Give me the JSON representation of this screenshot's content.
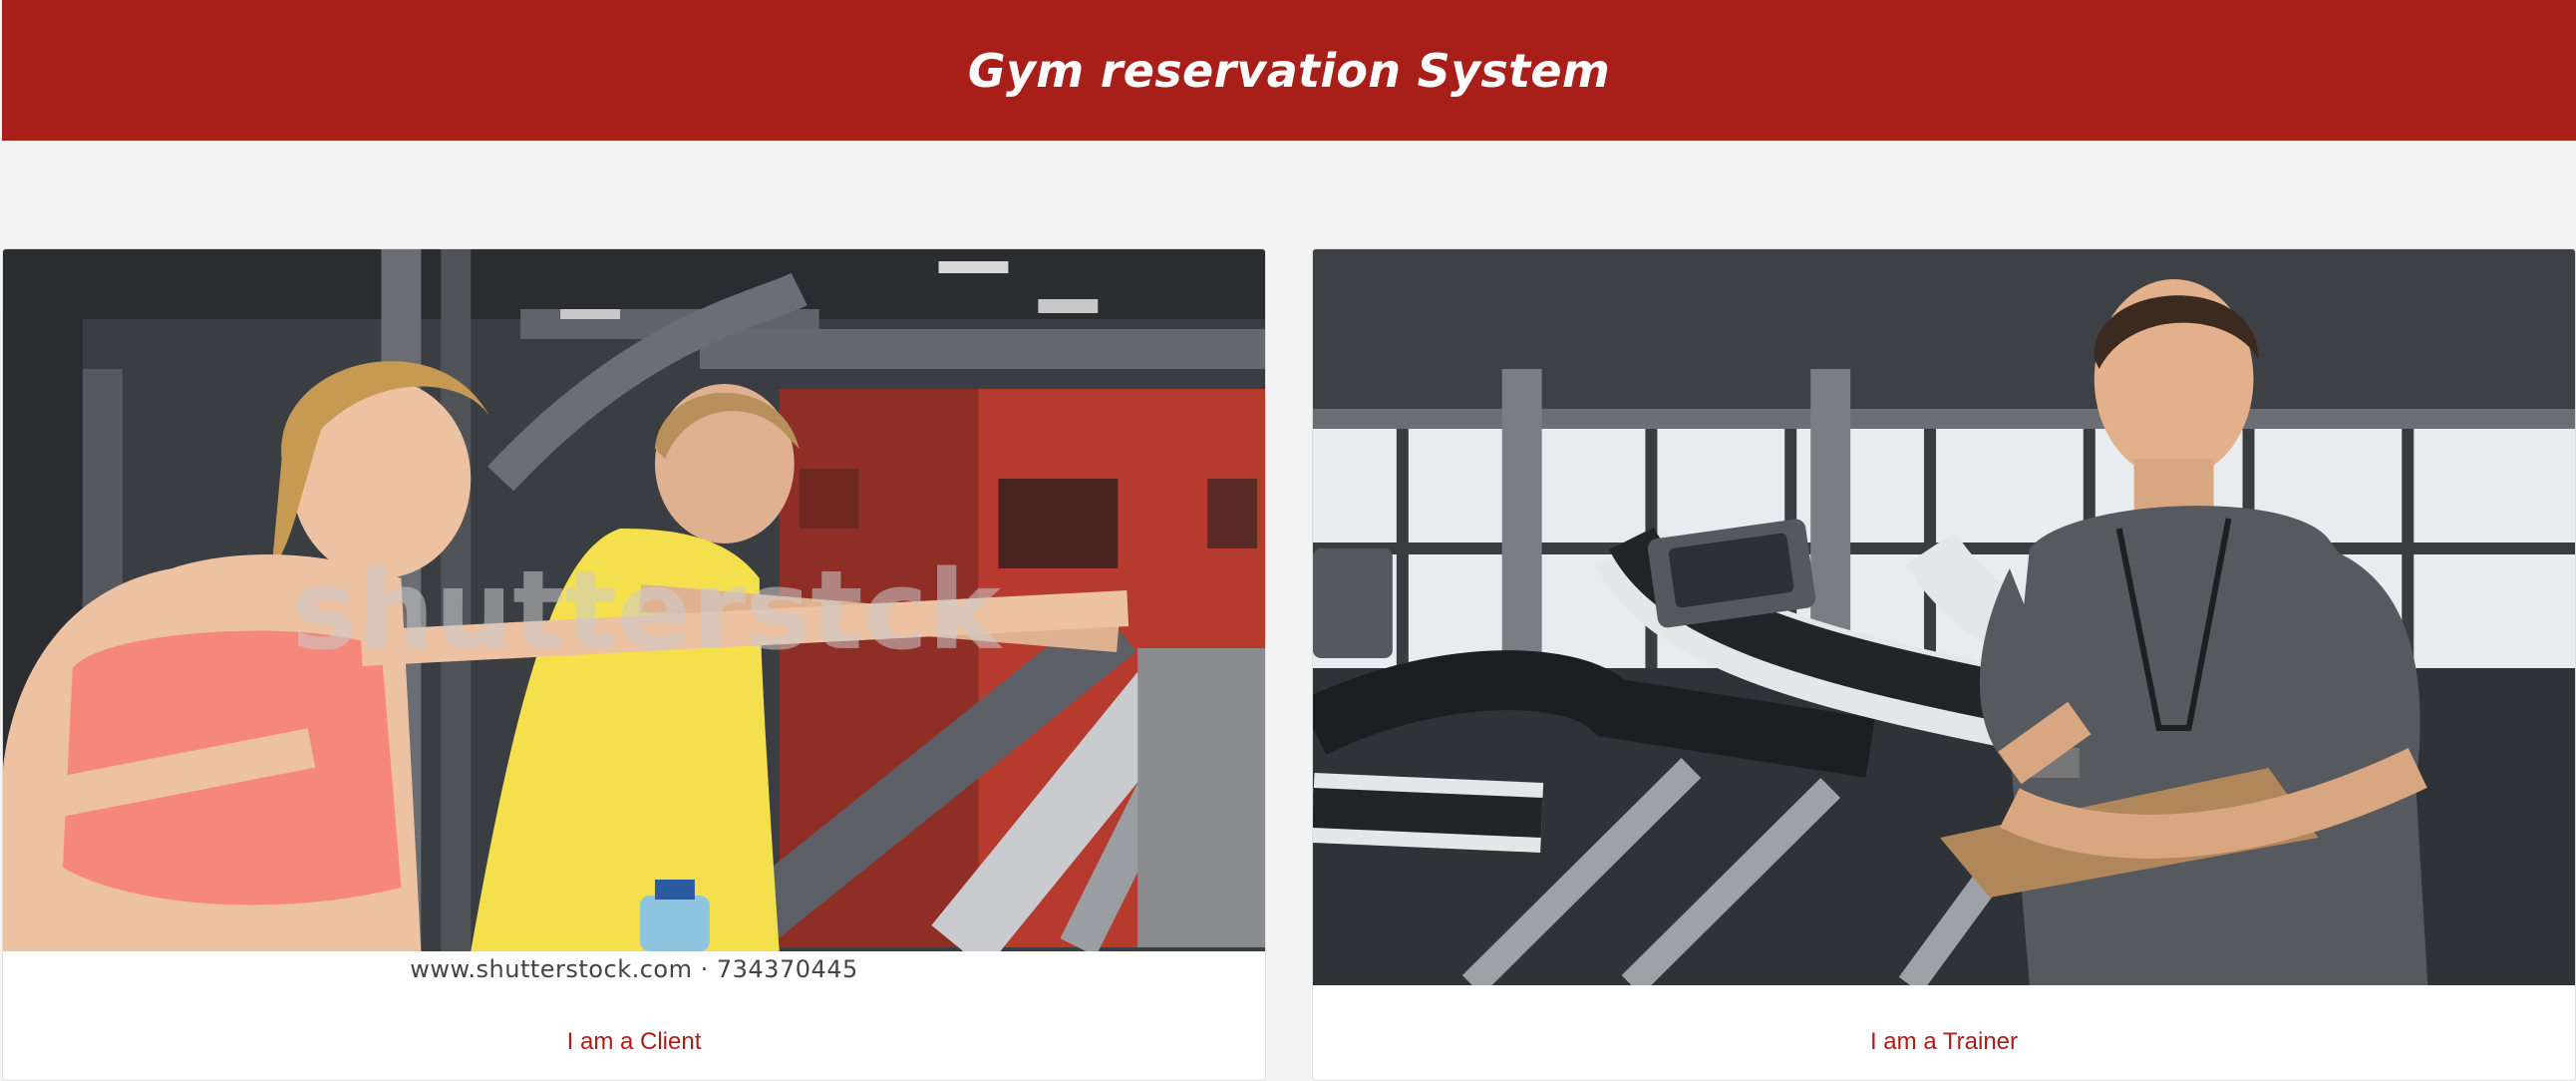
{
  "header": {
    "title": "Gym reservation System"
  },
  "cards": {
    "client": {
      "link_label": "I am a Client",
      "image_watermark": "shutterstck",
      "image_caption": "www.shutterstock.com · 734370445"
    },
    "trainer": {
      "link_label": "I am a Trainer"
    }
  },
  "colors": {
    "brand": "#a81f1a",
    "page_background": "#f3f3f3",
    "card_background": "#ffffff"
  }
}
